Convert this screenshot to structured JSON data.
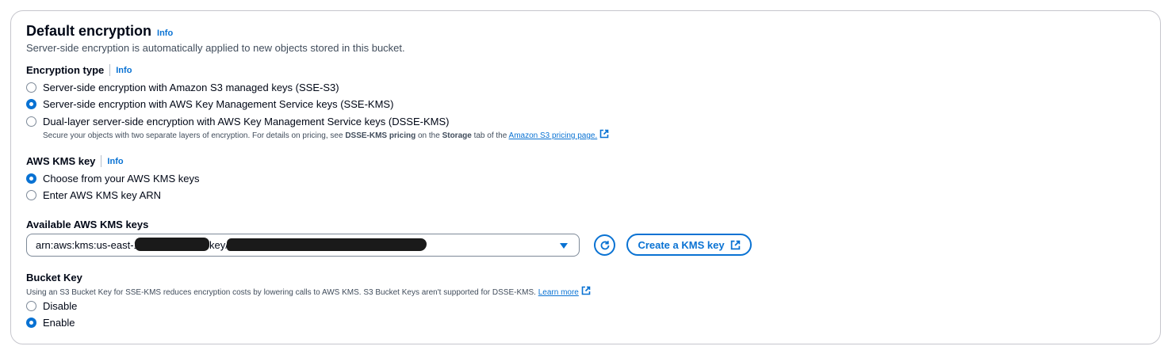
{
  "section": {
    "title": "Default encryption",
    "info": "Info",
    "description": "Server-side encryption is automatically applied to new objects stored in this bucket."
  },
  "encryption_type": {
    "label": "Encryption type",
    "info": "Info",
    "options": [
      {
        "label": "Server-side encryption with Amazon S3 managed keys (SSE-S3)",
        "selected": false
      },
      {
        "label": "Server-side encryption with AWS Key Management Service keys (SSE-KMS)",
        "selected": true
      },
      {
        "label": "Dual-layer server-side encryption with AWS Key Management Service keys (DSSE-KMS)",
        "selected": false
      }
    ],
    "dsse_note_prefix": "Secure your objects with two separate layers of encryption. For details on pricing, see ",
    "dsse_note_bold1": "DSSE-KMS pricing",
    "dsse_note_mid": " on the ",
    "dsse_note_bold2": "Storage",
    "dsse_note_suffix": " tab of the ",
    "dsse_note_link": "Amazon S3 pricing page."
  },
  "kms_key": {
    "label": "AWS KMS key",
    "info": "Info",
    "options": [
      {
        "label": "Choose from your AWS KMS keys",
        "selected": true
      },
      {
        "label": "Enter AWS KMS key ARN",
        "selected": false
      }
    ]
  },
  "available_keys": {
    "label": "Available AWS KMS keys",
    "value_prefix": "arn:aws:kms:us-east-1",
    "value_mid": "key/",
    "create_button": "Create a KMS key"
  },
  "bucket_key": {
    "label": "Bucket Key",
    "description": "Using an S3 Bucket Key for SSE-KMS reduces encryption costs by lowering calls to AWS KMS. S3 Bucket Keys aren't supported for DSSE-KMS.",
    "learn_more": "Learn more",
    "options": [
      {
        "label": "Disable",
        "selected": false
      },
      {
        "label": "Enable",
        "selected": true
      }
    ]
  },
  "colors": {
    "accent": "#0972d3",
    "text": "#000716",
    "secondary_text": "#414d5c",
    "border": "#c6c6cd"
  }
}
